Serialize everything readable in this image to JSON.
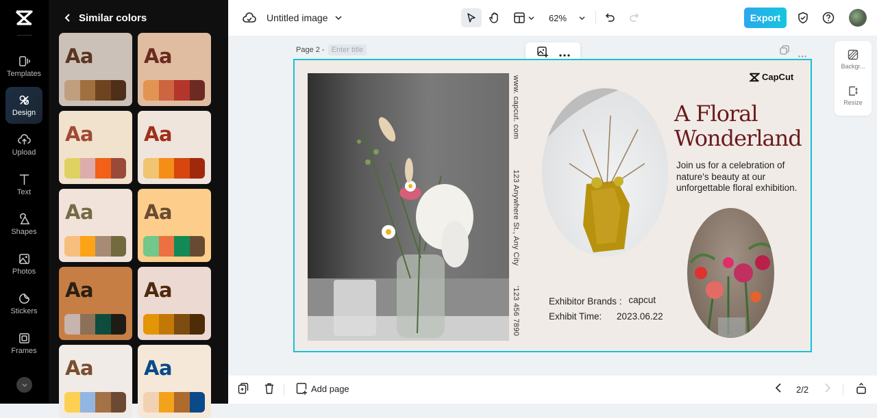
{
  "app": {
    "logo": "capcut-logo"
  },
  "rail": {
    "items": [
      {
        "label": "Templates",
        "icon": "templates-icon"
      },
      {
        "label": "Design",
        "icon": "design-icon",
        "active": true
      },
      {
        "label": "Upload",
        "icon": "upload-icon"
      },
      {
        "label": "Text",
        "icon": "text-icon"
      },
      {
        "label": "Shapes",
        "icon": "shapes-icon"
      },
      {
        "label": "Photos",
        "icon": "photos-icon"
      },
      {
        "label": "Stickers",
        "icon": "stickers-icon"
      },
      {
        "label": "Frames",
        "icon": "frames-icon"
      }
    ]
  },
  "panel": {
    "title": "Similar colors",
    "cards": [
      {
        "label": "Aa",
        "bg": "#cbc1b8",
        "text": "#5a3520",
        "swatches": [
          "#c09e7e",
          "#a0703f",
          "#6e4320",
          "#4e2f1a"
        ]
      },
      {
        "label": "Aa",
        "bg": "#e0bda0",
        "text": "#6a2a20",
        "swatches": [
          "#e29453",
          "#cc6540",
          "#b4352b",
          "#6c2a22"
        ]
      },
      {
        "label": "Aa",
        "bg": "#f1e2cd",
        "text": "#a04a34",
        "swatches": [
          "#e0d163",
          "#dcadac",
          "#f36017",
          "#9a4a38"
        ]
      },
      {
        "label": "Aa",
        "bg": "#efe5dc",
        "text": "#a0301a",
        "swatches": [
          "#f0c470",
          "#f48e16",
          "#d6460e",
          "#a0290c"
        ]
      },
      {
        "label": "Aa",
        "bg": "#f2e3da",
        "text": "#766b44",
        "swatches": [
          "#f6bf7e",
          "#fca318",
          "#a78b75",
          "#736a40"
        ]
      },
      {
        "label": "Aa",
        "bg": "#fdcd8b",
        "text": "#6a4c34",
        "swatches": [
          "#72c78a",
          "#ec7040",
          "#118a55",
          "#684a32"
        ]
      },
      {
        "label": "Aa",
        "bg": "#c77e45",
        "text": "#2a2015",
        "swatches": [
          "#c6b4ad",
          "#8c7058",
          "#0e4c3f",
          "#1e1c15"
        ]
      },
      {
        "label": "Aa",
        "bg": "#ecd9d1",
        "text": "#4d2a0d",
        "swatches": [
          "#e29605",
          "#c27806",
          "#7c4c10",
          "#4e2c08"
        ]
      },
      {
        "label": "Aa",
        "bg": "#f0ebe6",
        "text": "#7b4e30",
        "swatches": [
          "#fcd052",
          "#92b6e3",
          "#a57146",
          "#6c4a32"
        ]
      },
      {
        "label": "Aa",
        "bg": "#f6e8d8",
        "text": "#0a4a8a",
        "swatches": [
          "#f2d1b2",
          "#f3a21c",
          "#ae6b2d",
          "#0a4a8a"
        ]
      }
    ]
  },
  "topbar": {
    "doc_title": "Untitled image",
    "zoom": "62%",
    "export_label": "Export"
  },
  "canvas": {
    "page_label": "Page 2 -",
    "page_title_placeholder": "Enter title"
  },
  "poster": {
    "brand": "CapCut",
    "website": "www. capcut. com",
    "address": "123 Anywhere St., Any City",
    "phone": "'123 456 7890",
    "title_line1": "A Floral",
    "title_line2": "Wonderland",
    "description": "Join us for a celebration of nature's beauty at our unforgettable floral exhibition.",
    "brands_label": "Exhibitor Brands :",
    "brands_value": "capcut",
    "time_label": "Exhibit Time:",
    "time_value": "2023.06.22",
    "accent": "#6b1a1d"
  },
  "side_tools": [
    {
      "label": "Backgr...",
      "icon": "background-icon"
    },
    {
      "label": "Resize",
      "icon": "resize-icon"
    }
  ],
  "bottombar": {
    "add_page": "Add page",
    "page_indicator": "2/2"
  }
}
